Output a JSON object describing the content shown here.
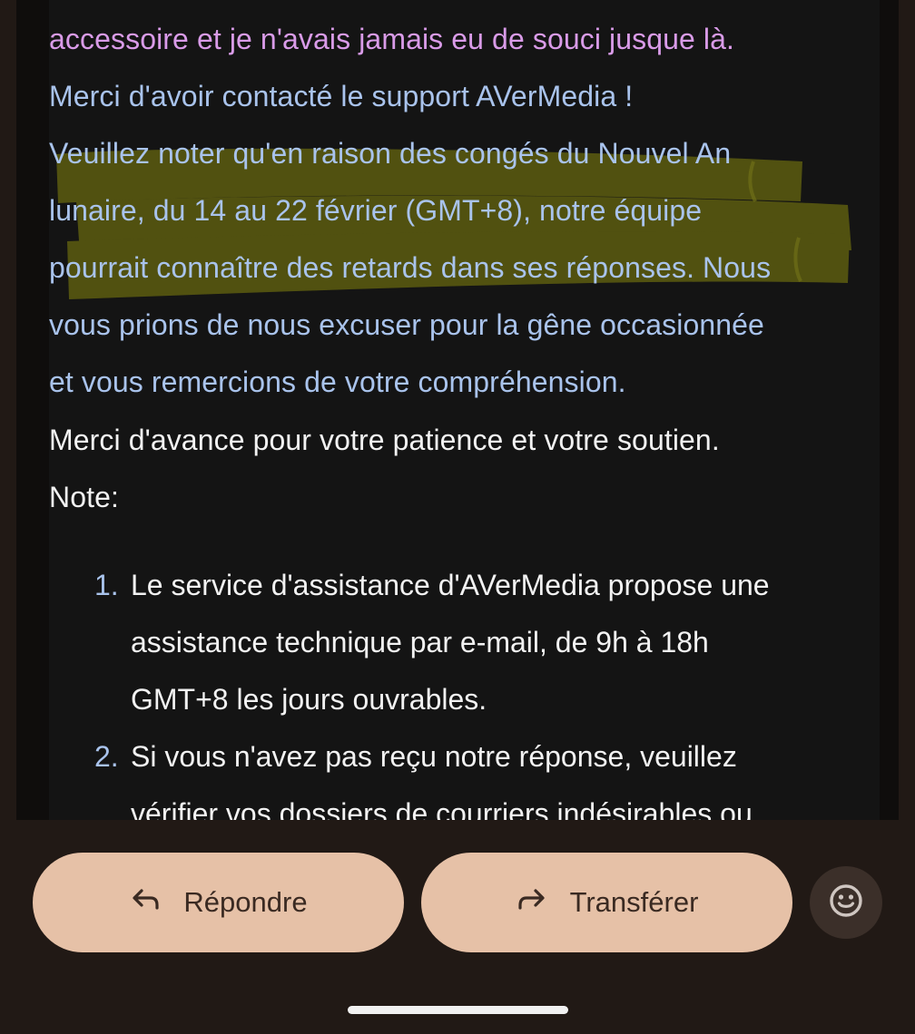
{
  "email": {
    "lines": [
      {
        "text": "accessoire et je n'avais jamais eu de souci jusque là.",
        "tone": "quoted"
      },
      {
        "text": "Merci d'avoir contacté le support AVerMedia !",
        "tone": "support"
      },
      {
        "text": "Veuillez noter qu'en raison des congés du Nouvel An",
        "tone": "support"
      },
      {
        "text": "lunaire, du 14 au 22 février (GMT+8), notre équipe",
        "tone": "support"
      },
      {
        "text": "pourrait connaître des retards dans ses réponses. Nous",
        "tone": "support"
      },
      {
        "text": "vous prions de nous excuser pour la gêne occasionnée",
        "tone": "support"
      },
      {
        "text": "et vous remercions de votre compréhension.",
        "tone": "support"
      },
      {
        "text": "Merci d'avance pour votre patience et votre soutien.",
        "tone": "body"
      },
      {
        "text": "Note:",
        "tone": "body"
      }
    ],
    "notes": [
      {
        "number": "1.",
        "lines": [
          "Le service d'assistance d'AVerMedia propose une",
          "assistance technique par e-mail, de 9h à 18h",
          "GMT+8 les jours ouvrables."
        ]
      },
      {
        "number": "2.",
        "lines": [
          "Si vous n'avez pas reçu notre réponse, veuillez",
          "vérifier vos dossiers de courriers indésirables ou"
        ]
      }
    ]
  },
  "actions": {
    "reply_label": "Répondre",
    "forward_label": "Transférer",
    "reply_icon": "reply-arrow-icon",
    "forward_icon": "forward-arrow-icon",
    "emoji_icon": "smiley-icon"
  },
  "colors": {
    "quoted_text": "#d99be8",
    "support_text": "#a9c3ec",
    "body_text": "#f2f2f2",
    "highlighter": "#5f5f10",
    "button_fill": "#e6c1a7",
    "background": "#211915"
  }
}
